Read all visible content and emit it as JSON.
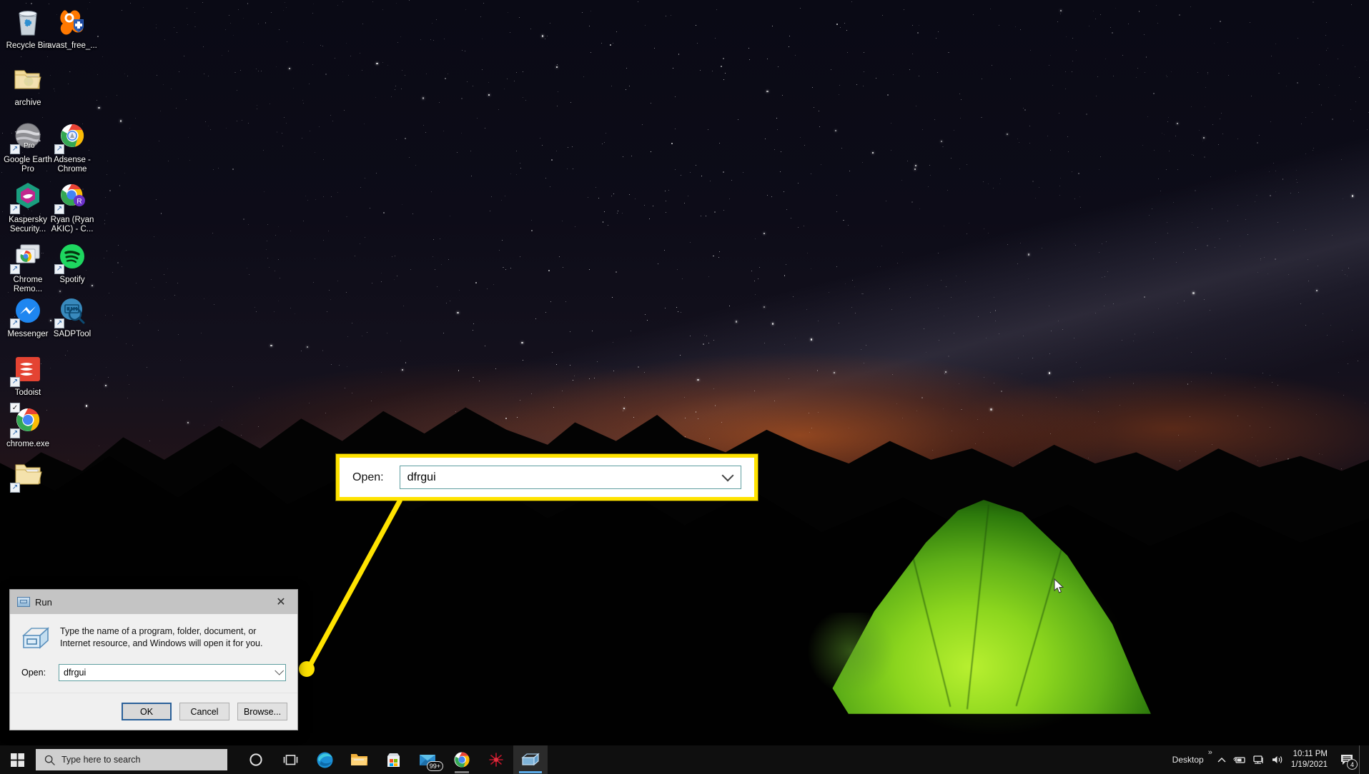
{
  "desktop": {
    "icons": [
      {
        "label": "Recycle Bin",
        "icon": "recycle-bin-icon",
        "shortcut": false
      },
      {
        "label": "avast_free_...",
        "icon": "avast-icon",
        "shortcut": false
      },
      {
        "label": "archive",
        "icon": "folder-icon",
        "shortcut": false
      },
      {
        "label": "Google Earth Pro",
        "icon": "google-earth-pro-icon",
        "shortcut": true
      },
      {
        "label": "Adsense - Chrome",
        "icon": "chrome-shortcut-icon",
        "shortcut": true
      },
      {
        "label": "Kaspersky Security...",
        "icon": "kaspersky-icon",
        "shortcut": true
      },
      {
        "label": "Ryan (Ryan AKIC) - C...",
        "icon": "chrome-profile-icon",
        "shortcut": true
      },
      {
        "label": "Chrome Remo...",
        "icon": "chrome-remote-desktop-icon",
        "shortcut": true
      },
      {
        "label": "Spotify",
        "icon": "spotify-icon",
        "shortcut": true
      },
      {
        "label": "Messenger",
        "icon": "messenger-icon",
        "shortcut": true
      },
      {
        "label": "SADPTool",
        "icon": "sadptool-icon",
        "shortcut": true
      },
      {
        "label": "Todoist",
        "icon": "todoist-icon",
        "shortcut": true
      },
      {
        "label": "chrome.exe",
        "icon": "chrome-icon",
        "shortcut": true
      },
      {
        "label": "",
        "icon": "folder-icon",
        "shortcut": true
      }
    ]
  },
  "run_dialog": {
    "title": "Run",
    "title_icon": "run-window-icon",
    "close_label": "✕",
    "description": "Type the name of a program, folder, document, or Internet resource, and Windows will open it for you.",
    "open_label": "Open:",
    "open_value": "dfrgui",
    "dropdown_icon": "chevron-down-icon",
    "buttons": {
      "ok": "OK",
      "cancel": "Cancel",
      "browse": "Browse..."
    }
  },
  "callout": {
    "open_label": "Open:",
    "open_value": "dfrgui",
    "dropdown_icon": "chevron-down-icon",
    "border_color": "#ffe300",
    "line_color": "#ffe300"
  },
  "taskbar": {
    "start_icon": "windows-start-icon",
    "search": {
      "icon": "search-icon",
      "placeholder": "Type here to search"
    },
    "items": [
      {
        "name": "cortana-icon",
        "label": "Cortana"
      },
      {
        "name": "task-view-icon",
        "label": "Task View"
      },
      {
        "name": "microsoft-edge-icon",
        "label": "Microsoft Edge"
      },
      {
        "name": "file-explorer-icon",
        "label": "File Explorer"
      },
      {
        "name": "microsoft-store-icon",
        "label": "Microsoft Store"
      },
      {
        "name": "mail-icon",
        "label": "Mail",
        "badge": "99+"
      },
      {
        "name": "google-chrome-icon",
        "label": "Google Chrome"
      },
      {
        "name": "firework-app-icon",
        "label": "App"
      },
      {
        "name": "run-window-icon",
        "label": "Run"
      }
    ],
    "tray": {
      "desktop_label": "Desktop",
      "overflow_icon": "chevron-up-icon",
      "icons": [
        "pen-battery-icon",
        "network-icon",
        "volume-icon"
      ],
      "time": "10:11 PM",
      "date": "1/19/2021",
      "notification_icon": "notification-icon",
      "notification_count": "4"
    }
  }
}
